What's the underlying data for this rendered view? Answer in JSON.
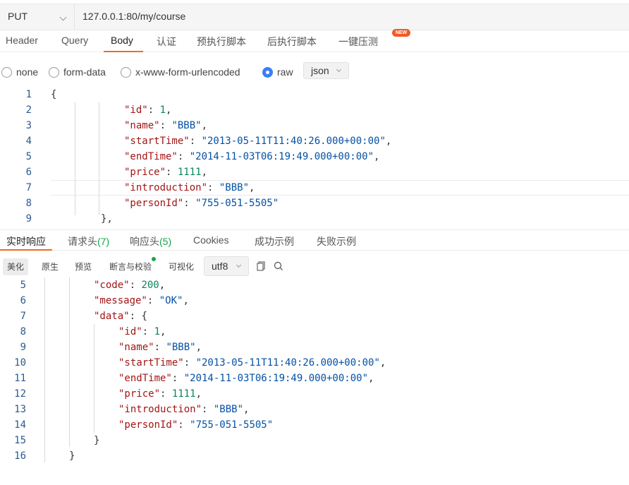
{
  "request": {
    "method": "PUT",
    "url": "127.0.0.1:80/my/course"
  },
  "tabs": [
    {
      "label": "Header"
    },
    {
      "label": "Query"
    },
    {
      "label": "Body"
    },
    {
      "label": "认证"
    },
    {
      "label": "预执行脚本"
    },
    {
      "label": "后执行脚本"
    },
    {
      "label": "一键压测"
    }
  ],
  "new_badge": "NEW",
  "body_types": [
    {
      "label": "none"
    },
    {
      "label": "form-data"
    },
    {
      "label": "x-www-form-urlencoded"
    },
    {
      "label": "raw"
    }
  ],
  "raw_format": "json",
  "request_body": {
    "line_numbers": [
      "1",
      "2",
      "3",
      "4",
      "5",
      "6",
      "7",
      "8",
      "9"
    ],
    "brace_open": "{",
    "brace_close": "},",
    "fields": [
      {
        "key": "\"id\"",
        "value": "1"
      },
      {
        "key": "\"name\"",
        "value": "\"BBB\""
      },
      {
        "key": "\"startTime\"",
        "value": "\"2013-05-11T11:40:26.000+00:00\""
      },
      {
        "key": "\"endTime\"",
        "value": "\"2014-11-03T06:19:49.000+00:00\""
      },
      {
        "key": "\"price\"",
        "value": "1111"
      },
      {
        "key": "\"introduction\"",
        "value": "\"BBB\""
      },
      {
        "key": "\"personId\"",
        "value": "\"755-051-5505\""
      }
    ]
  },
  "response_tabs": [
    {
      "label": "实时响应"
    },
    {
      "label": "请求头",
      "count": "(7)"
    },
    {
      "label": "响应头",
      "count": "(5)"
    },
    {
      "label": "Cookies"
    },
    {
      "label": "成功示例"
    },
    {
      "label": "失败示例"
    }
  ],
  "response_toolbar": {
    "beautify": "美化",
    "raw": "原生",
    "preview": "预览",
    "assert": "断言与校验",
    "visualize": "可视化",
    "encoding": "utf8"
  },
  "response_body": {
    "line_numbers": [
      "5",
      "6",
      "7",
      "8",
      "9",
      "10",
      "11",
      "12",
      "13",
      "14",
      "15",
      "16"
    ],
    "code_key": "\"code\"",
    "code_value": "200",
    "message_key": "\"message\"",
    "message_value": "\"OK\"",
    "data_key": "\"data\"",
    "data_open": "{",
    "fields": [
      {
        "key": "\"id\"",
        "value": "1"
      },
      {
        "key": "\"name\"",
        "value": "\"BBB\""
      },
      {
        "key": "\"startTime\"",
        "value": "\"2013-05-11T11:40:26.000+00:00\""
      },
      {
        "key": "\"endTime\"",
        "value": "\"2014-11-03T06:19:49.000+00:00\""
      },
      {
        "key": "\"price\"",
        "value": "1111"
      },
      {
        "key": "\"introduction\"",
        "value": "\"BBB\""
      },
      {
        "key": "\"personId\"",
        "value": "\"755-051-5505\""
      }
    ],
    "data_close": "}",
    "root_close": "}"
  },
  "colors": {
    "accent": "#f36a21",
    "radio_checked": "#3a7ff5",
    "count_green": "#19a34a",
    "json_key": "#a31515",
    "json_string": "#0451a5",
    "json_number": "#098658"
  }
}
